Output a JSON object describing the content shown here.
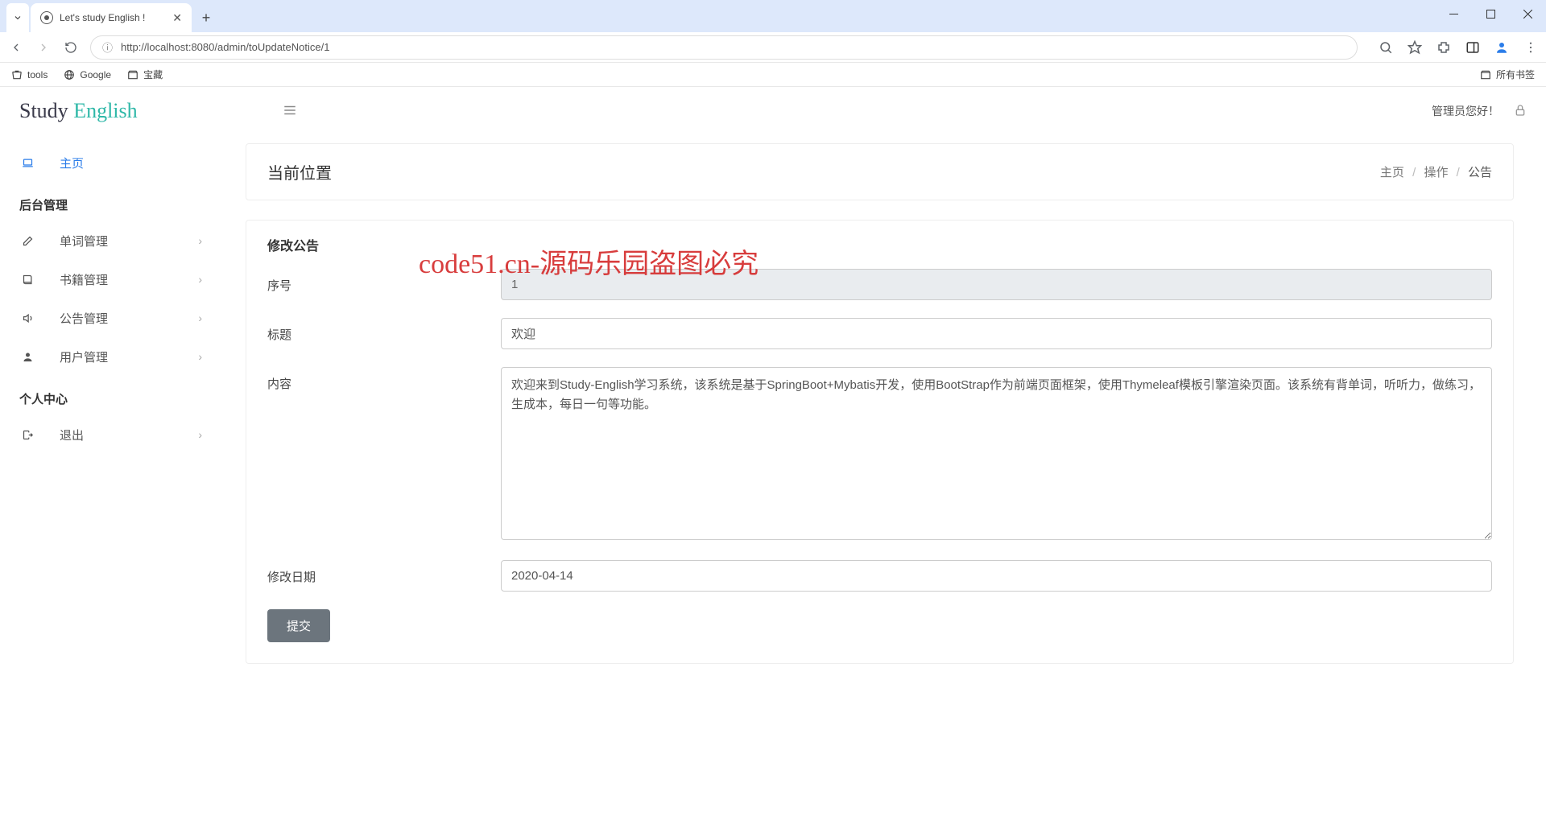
{
  "browser": {
    "tab_title": "Let's study English !",
    "url_display": "http://localhost:8080/admin/toUpdateNotice/1",
    "bookmarks": {
      "tools": "tools",
      "google": "Google",
      "baozang": "宝藏",
      "all": "所有书签"
    }
  },
  "header": {
    "logo_a": "Study",
    "logo_b": "English",
    "greeting": "管理员您好！"
  },
  "sidebar": {
    "home": "主页",
    "section_admin": "后台管理",
    "words": "单词管理",
    "books": "书籍管理",
    "notice": "公告管理",
    "users": "用户管理",
    "section_personal": "个人中心",
    "logout": "退出"
  },
  "location": {
    "title": "当前位置",
    "crumb1": "主页",
    "crumb2": "操作",
    "crumb3": "公告"
  },
  "form": {
    "panel_title": "修改公告",
    "id_label": "序号",
    "id_value": "1",
    "title_label": "标题",
    "title_value": "欢迎",
    "content_label": "内容",
    "content_value": "欢迎来到Study-English学习系统，该系统是基于SpringBoot+Mybatis开发，使用BootStrap作为前端页面框架，使用Thymeleaf模板引擎渲染页面。该系统有背单词，听听力，做练习，生成本，每日一句等功能。",
    "date_label": "修改日期",
    "date_value": "2020-04-14",
    "submit": "提交"
  },
  "watermark": {
    "small": "code51.cn",
    "big": "code51.cn-源码乐园盗图必究"
  }
}
